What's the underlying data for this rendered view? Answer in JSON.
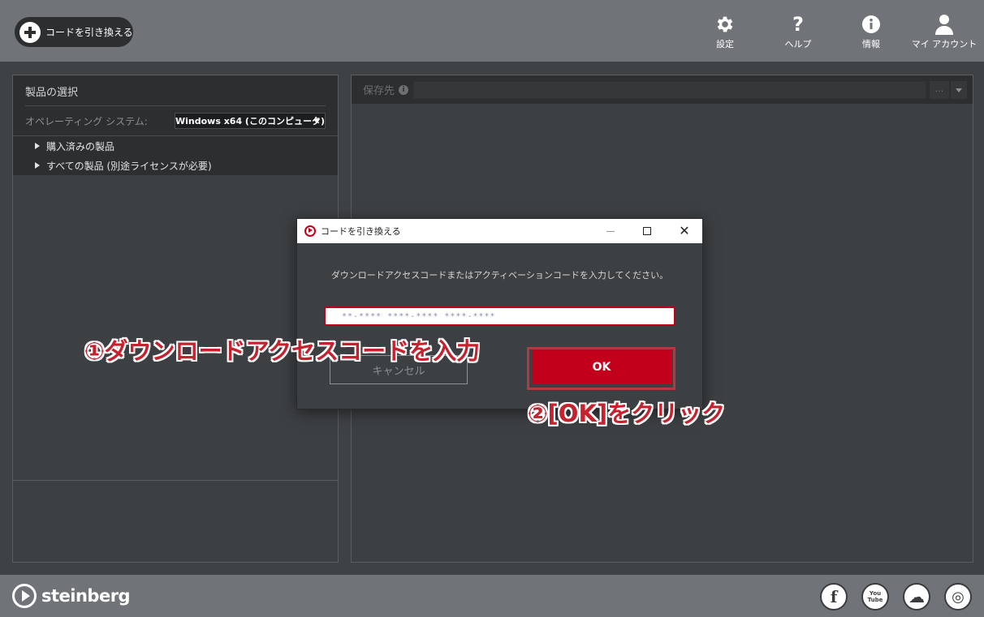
{
  "header": {
    "redeem_label": "コードを引き換える",
    "nav": [
      {
        "label": "設定",
        "icon": "gear-icon"
      },
      {
        "label": "ヘルプ",
        "icon": "question-icon"
      },
      {
        "label": "情報",
        "icon": "info-icon"
      },
      {
        "label": "マイ アカウント",
        "icon": "user-icon"
      }
    ]
  },
  "left_panel": {
    "title": "製品の選択",
    "os_label": "オペレーティング システム:",
    "os_value": "Windows x64 (このコンピュータ)",
    "tree": [
      {
        "label": "購入済みの製品"
      },
      {
        "label": "すべての製品 (別途ライセンスが必要)"
      }
    ]
  },
  "right_panel": {
    "dest_label": "保存先",
    "browse_label": "..."
  },
  "dialog": {
    "title": "コードを引き換える",
    "message": "ダウンロードアクセスコードまたはアクティベーションコードを入力してください。",
    "code_value": "**-**** ****-**** ****-****",
    "cancel_label": "キャンセル",
    "ok_label": "OK"
  },
  "annotations": {
    "step1": "①ダウンロードアクセスコードを入力",
    "step2": "②[OK]をクリック"
  },
  "footer": {
    "brand": "steinberg",
    "social": [
      {
        "name": "facebook-icon",
        "glyph": "f"
      },
      {
        "name": "youtube-icon",
        "glyph": "You Tube"
      },
      {
        "name": "soundcloud-icon",
        "glyph": "☁"
      },
      {
        "name": "instagram-icon",
        "glyph": "◎"
      }
    ]
  },
  "colors": {
    "accent": "#c3001c",
    "topbar": "#707478",
    "panel": "#3d4043",
    "panel_head": "#2c2e30"
  }
}
